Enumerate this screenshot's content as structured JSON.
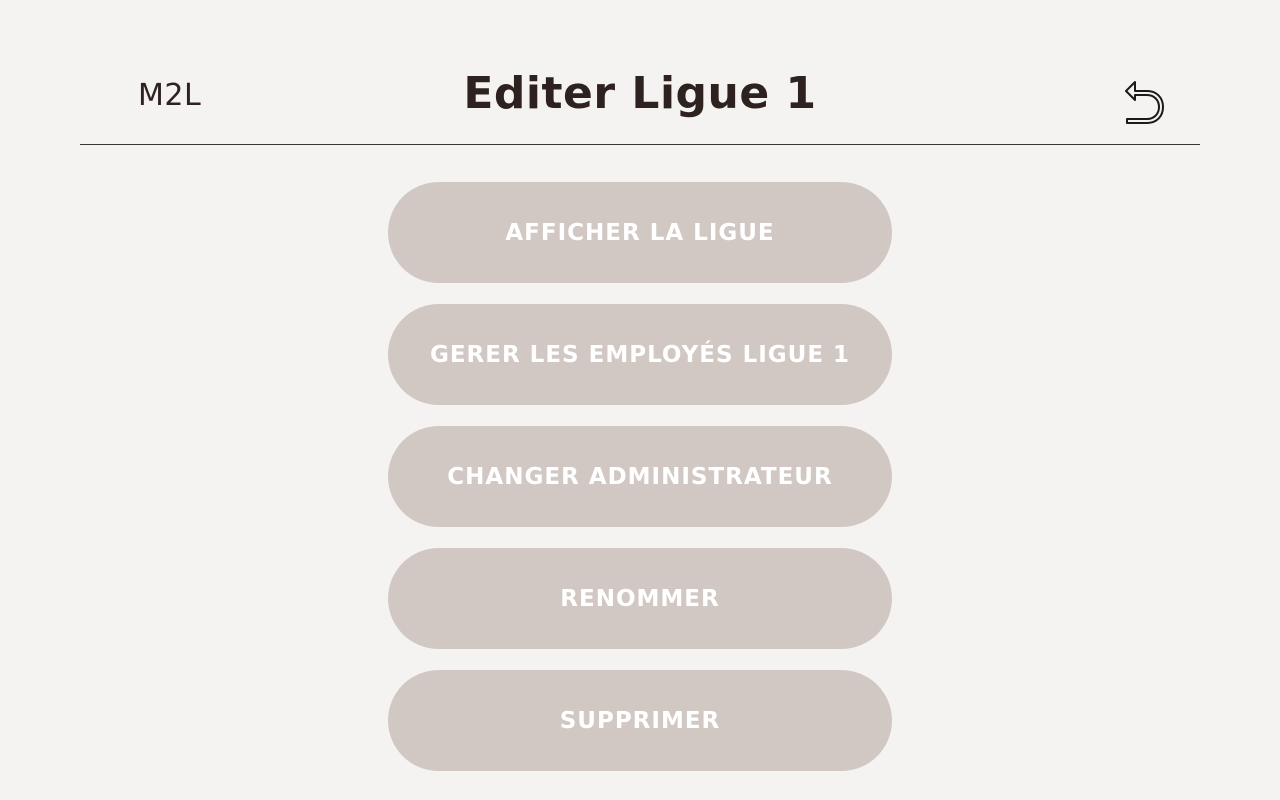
{
  "header": {
    "brand": "M2L",
    "title": "Editer Ligue 1",
    "back_icon": "back-arrow-icon"
  },
  "actions": [
    {
      "label": "AFFICHER LA LIGUE"
    },
    {
      "label": "GERER LES EMPLOYÉS LIGUE 1"
    },
    {
      "label": "CHANGER ADMINISTRATEUR"
    },
    {
      "label": "RENOMMER"
    },
    {
      "label": "SUPPRIMER"
    }
  ],
  "colors": {
    "background": "#f5f3f1",
    "button": "#d1c8c3",
    "button_text": "#ffffff",
    "heading": "#2e2220"
  }
}
